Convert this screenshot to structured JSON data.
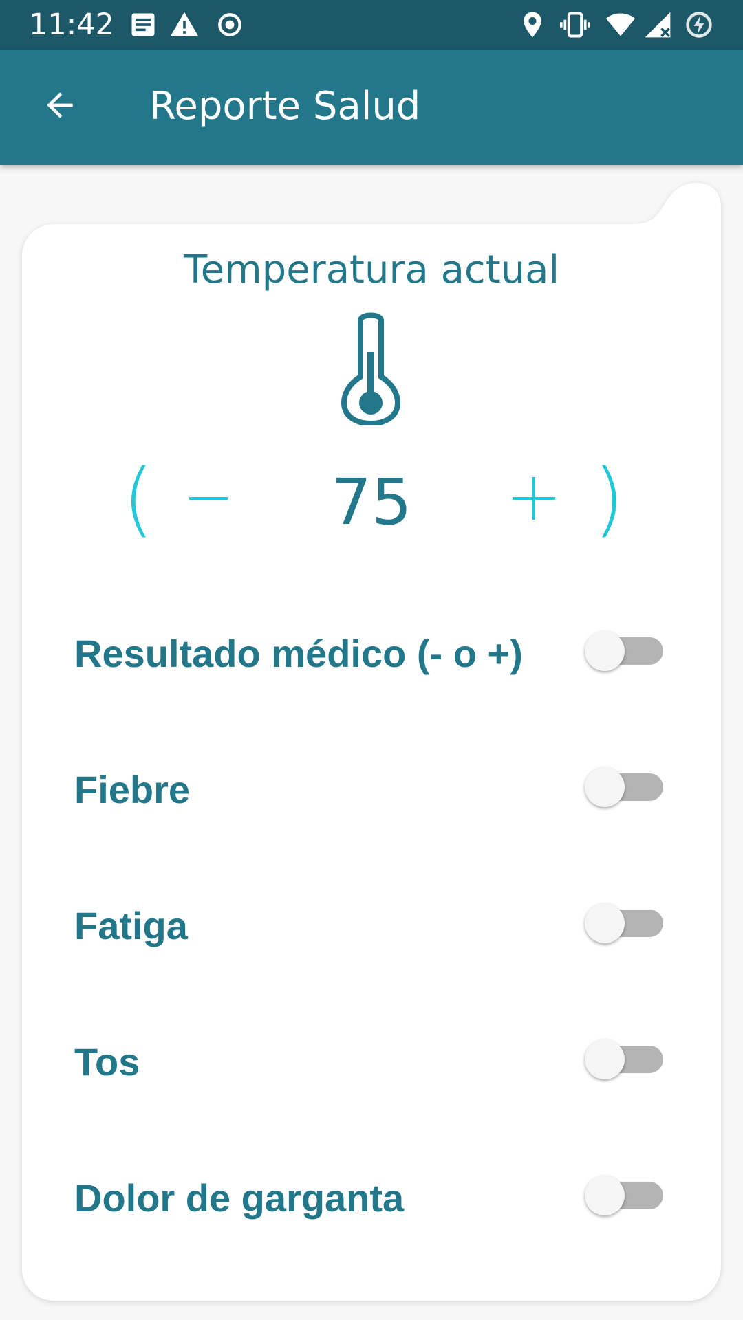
{
  "status_bar": {
    "time": "11:42",
    "left_icons": [
      "notes-icon",
      "warning-icon",
      "radio-icon"
    ],
    "right_icons": [
      "location-icon",
      "vibrate-icon",
      "wifi-icon",
      "signal-icon",
      "battery-saver-icon"
    ]
  },
  "app_bar": {
    "title": "Reporte Salud",
    "back_icon": "arrow-back-icon"
  },
  "temperature": {
    "title": "Temperatura actual",
    "value": "75",
    "minus_icon": "minus-icon",
    "plus_icon": "plus-icon",
    "open_paren": "(",
    "close_paren": ")"
  },
  "symptoms": [
    {
      "label": "Resultado médico (- o +)",
      "checked": false
    },
    {
      "label": "Fiebre",
      "checked": false
    },
    {
      "label": "Fatiga",
      "checked": false
    },
    {
      "label": "Tos",
      "checked": false
    },
    {
      "label": "Dolor de garganta",
      "checked": false
    }
  ],
  "colors": {
    "status_bar": "#1c5868",
    "app_bar": "#22788a",
    "primary_text": "#22788a",
    "accent": "#22c7d8",
    "toggle_track_off": "#b4b4b4",
    "background": "#f7f7f7"
  }
}
